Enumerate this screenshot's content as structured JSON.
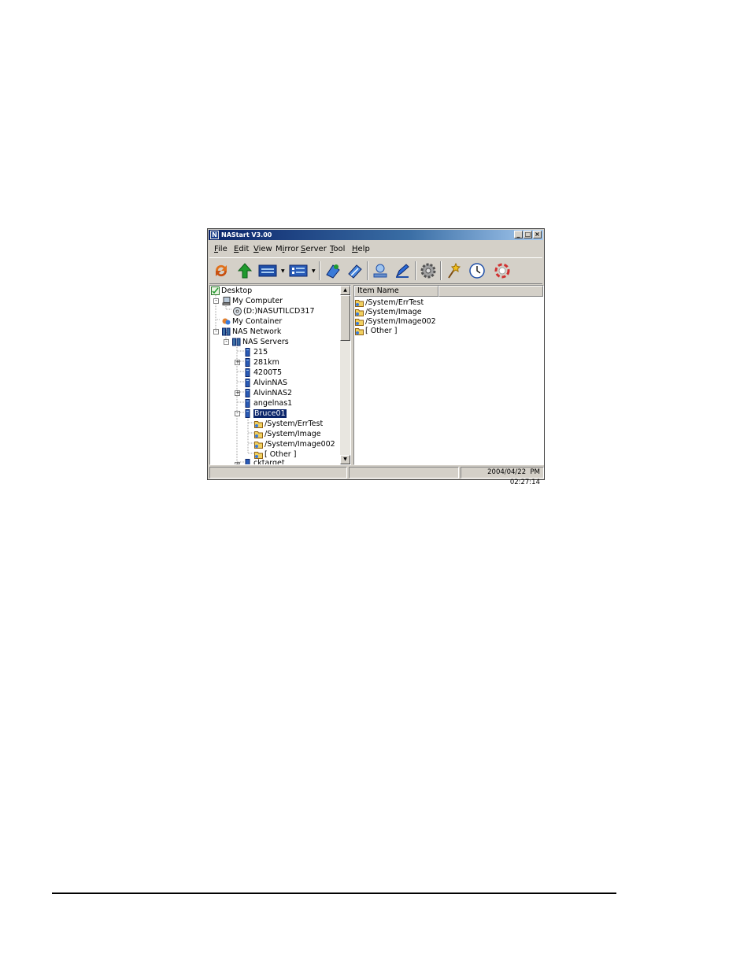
{
  "window": {
    "title": "NAStart V3.00",
    "app_icon_letter": "N",
    "controls": {
      "minimize": "_",
      "maximize": "□",
      "close": "×"
    }
  },
  "menu": {
    "file": {
      "accel": "F",
      "rest": "ile"
    },
    "edit": {
      "accel": "E",
      "rest": "dit"
    },
    "view": {
      "accel": "V",
      "rest": "iew"
    },
    "mirror": {
      "lead": "M",
      "accel": "i",
      "rest": "rror"
    },
    "server": {
      "accel": "S",
      "rest": "erver"
    },
    "tool": {
      "accel": "T",
      "rest": "ool"
    },
    "help": {
      "accel": "H",
      "rest": "elp"
    }
  },
  "toolbar": {
    "icons": [
      "refresh-icon",
      "up-arrow-icon",
      "view-large-icon",
      "view-details-icon",
      "mirror-icon",
      "copy-icon",
      "connect-icon",
      "edit-icon",
      "settings-gear-icon",
      "wizard-icon",
      "clock-icon",
      "help-lifebuoy-icon"
    ],
    "colors": {
      "refresh": "#e0701a",
      "up": "#1f9a2e",
      "accent": "#1f4fa8"
    }
  },
  "tree": {
    "desktop": "Desktop",
    "my_computer": "My Computer",
    "drive": "(D:)NASUTILCD317",
    "my_container": "My Container",
    "nas_network": "NAS Network",
    "nas_servers": "NAS Servers",
    "servers": {
      "s215": "215",
      "s281km": "281km",
      "s4200t5": "4200T5",
      "alvinnas": "AlvinNAS",
      "alvinnas2": "AlvinNAS2",
      "angelnas1": "angelnas1",
      "bruce01": "Bruce01"
    },
    "bruce01_items": {
      "errtest": "/System/ErrTest",
      "image": "/System/Image",
      "image002": "/System/Image002",
      "other": "[ Other ]"
    },
    "cut_off_item": "cktarget"
  },
  "list": {
    "column_header": "Item Name",
    "items": {
      "errtest": "/System/ErrTest",
      "image": "/System/Image",
      "image002": "/System/Image002",
      "other": "[ Other ]"
    }
  },
  "status": {
    "date": "2004/04/22",
    "time": "PM 02:27:14"
  }
}
